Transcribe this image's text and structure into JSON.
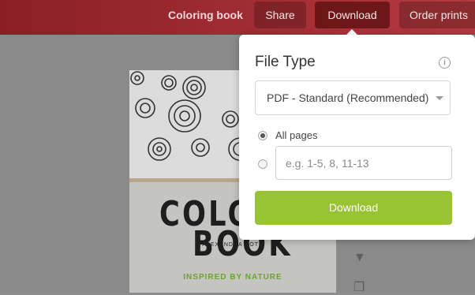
{
  "topbar": {
    "title": "Coloring book",
    "share_label": "Share",
    "download_label": "Download",
    "order_prints_label": "Order prints"
  },
  "cover": {
    "word1": "COLOR",
    "word2": "BOOK",
    "author": "ALEXANDRA COTE",
    "tagline": "INSPIRED BY NATURE"
  },
  "download_panel": {
    "title": "File Type",
    "info_icon": "info-icon",
    "file_type_selected": "PDF - Standard (Recommended)",
    "pages_option_all": "All pages",
    "pages_selected": "all",
    "range_placeholder": "e.g. 1-5, 8, 11-13",
    "download_button_label": "Download",
    "button_color": "#98c433"
  }
}
